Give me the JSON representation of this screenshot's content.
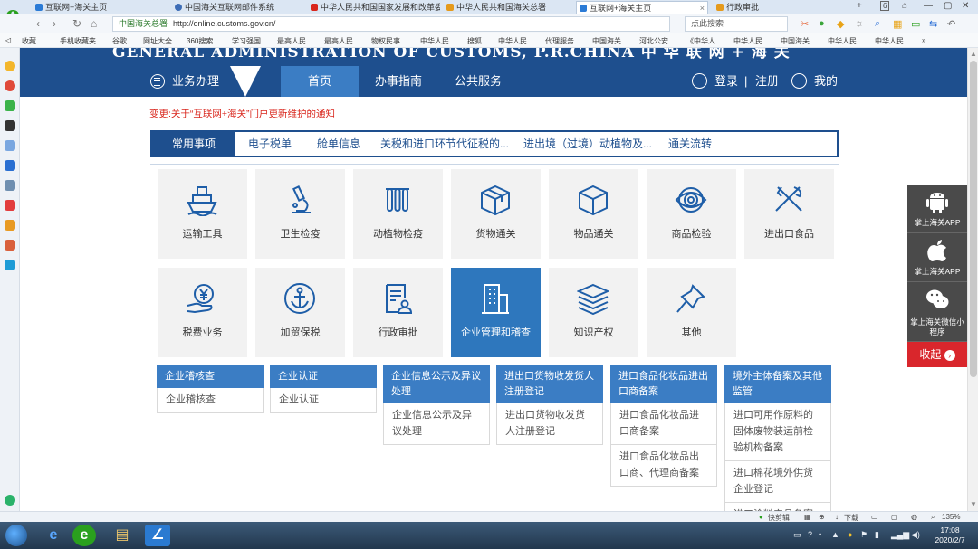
{
  "browser": {
    "tabs": [
      {
        "label": "互联网+海关主页",
        "icon_color": "#2b7bd6",
        "active": false
      },
      {
        "label": "中国海关互联网邮件系统",
        "icon_color": "#3d6db6",
        "active": false
      },
      {
        "label": "中华人民共和国国家发展和改革委",
        "icon_color": "#d9261c",
        "active": false
      },
      {
        "label": "中华人民共和国海关总署",
        "icon_color": "#e59a1c",
        "active": false
      },
      {
        "label": "互联网+海关主页",
        "icon_color": "#2b7bd6",
        "active": true
      },
      {
        "label": "行政审批",
        "icon_color": "#e59a1c",
        "active": false
      }
    ],
    "tab_count": "6",
    "site_label": "中国海关总署",
    "url": "http://online.customs.gov.cn/",
    "search_placeholder": "点此搜索",
    "bookmarks": [
      "收藏",
      "手机收藏夹",
      "谷歌",
      "网址大全",
      "360搜索",
      "学习强国",
      "最高人民",
      "最高人民",
      "物权民事",
      "中华人民",
      "搜狐",
      "中华人民",
      "代理服务",
      "中国海关",
      "河北公安",
      "《中华人",
      "中华人民",
      "中国海关",
      "中华人民",
      "中华人民"
    ]
  },
  "site": {
    "banner_title": "GENERAL ADMINISTRATION OF CUSTOMS, P.R.CHINA  中 华 联 网 + 海 关",
    "nav": {
      "menu_label": "业务办理",
      "items": [
        "首页",
        "办事指南",
        "公共服务"
      ],
      "active_index": 0,
      "login": "登录",
      "separator": "|",
      "register": "注册",
      "mine": "我的"
    },
    "notice": "变更:关于“互联网+海关”门户更新维护的通知",
    "tabbar": [
      "常用事项",
      "电子税单",
      "舱单信息",
      "关税和进口环节代征税的...",
      "进出境（过境）动植物及...",
      "通关流转"
    ],
    "tiles_row1": [
      {
        "label": "运输工具",
        "icon": "ship-icon"
      },
      {
        "label": "卫生检疫",
        "icon": "microscope-icon"
      },
      {
        "label": "动植物检疫",
        "icon": "tubes-icon"
      },
      {
        "label": "货物通关",
        "icon": "box-icon"
      },
      {
        "label": "物品通关",
        "icon": "cube-icon"
      },
      {
        "label": "商品检验",
        "icon": "eye-icon"
      },
      {
        "label": "进出口食品",
        "icon": "utensils-icon"
      }
    ],
    "tiles_row2": [
      {
        "label": "税费业务",
        "icon": "yen-hand-icon"
      },
      {
        "label": "加贸保税",
        "icon": "anchor-icon"
      },
      {
        "label": "行政审批",
        "icon": "document-user-icon"
      },
      {
        "label": "企业管理和稽查",
        "icon": "building-icon"
      },
      {
        "label": "知识产权",
        "icon": "layers-icon"
      },
      {
        "label": "其他",
        "icon": "pin-icon"
      }
    ],
    "columns": [
      {
        "head": "企业稽核查",
        "items": [
          "企业稽核查"
        ]
      },
      {
        "head": "企业认证",
        "items": [
          "企业认证"
        ]
      },
      {
        "head": "企业信息公示及异议处理",
        "items": [
          "企业信息公示及异议处理"
        ]
      },
      {
        "head": "进出口货物收发货人注册登记",
        "items": [
          "进出口货物收发货人注册登记"
        ]
      },
      {
        "head": "进口食品化妆品进出口商备案",
        "items": [
          "进口食品化妆品进口商备案",
          "进口食品化妆品出口商、代理商备案"
        ]
      },
      {
        "head": "境外主体备案及其他监管",
        "items": [
          "进口可用作原料的固体废物装运前检验机构备案",
          "进口棉花境外供货企业登记",
          "进口涂料产品备案"
        ]
      }
    ],
    "float": [
      {
        "label": "掌上海关APP",
        "icon": "android-icon"
      },
      {
        "label": "掌上海关APP",
        "icon": "apple-icon"
      },
      {
        "label": "掌上海关微信小程序",
        "icon": "wechat-icon"
      }
    ],
    "collapse_label": "收起"
  },
  "statusbar": {
    "left": "快剪辑",
    "download": "下载",
    "zoom": "135%"
  },
  "taskbar": {
    "time": "17:08",
    "date": "2020/2/7"
  },
  "colors": {
    "primary": "#1e4f8e",
    "accent": "#3b7dc4",
    "notice": "#d9261c",
    "tile_active": "#2e77bd"
  }
}
